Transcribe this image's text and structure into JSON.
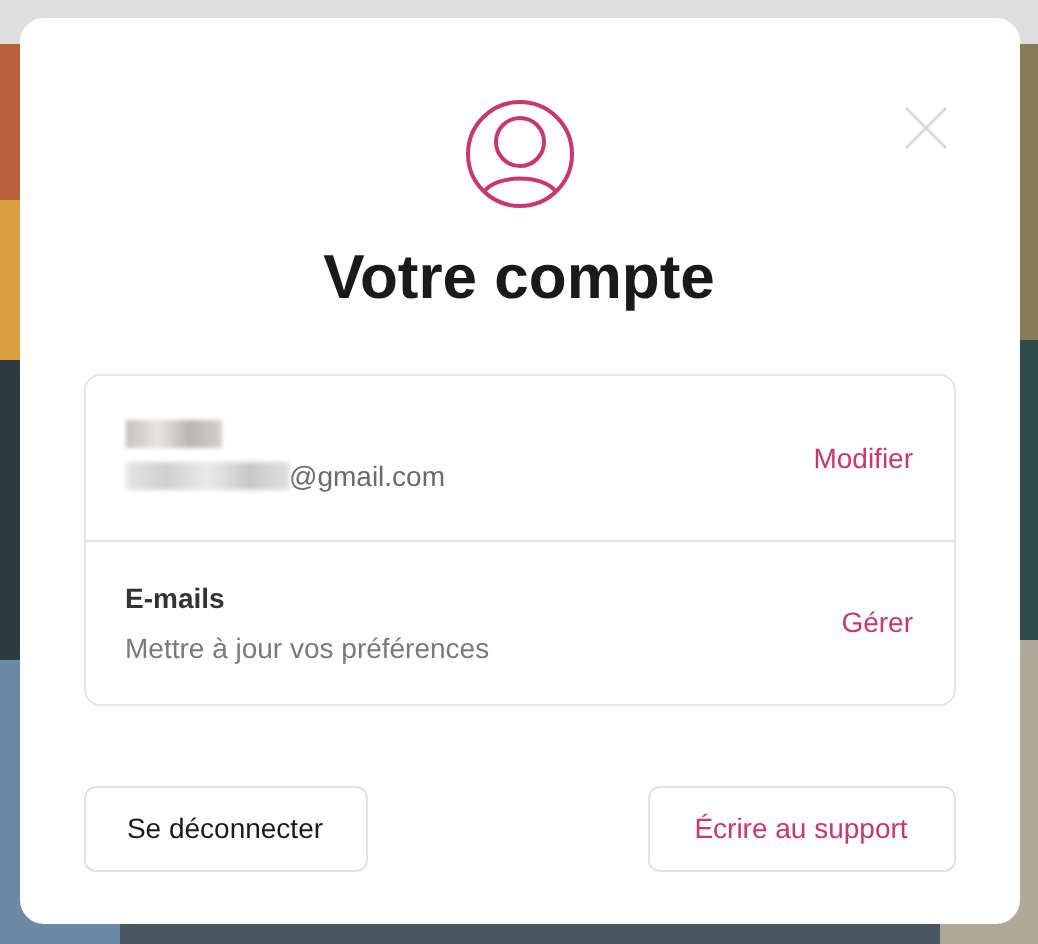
{
  "dialog": {
    "title": "Votre compte"
  },
  "account_rows": [
    {
      "kind": "profile",
      "email_visible": "@gmail.com",
      "action": "Modifier"
    },
    {
      "kind": "setting",
      "title": "E-mails",
      "subtitle": "Mettre à jour vos préférences",
      "action": "Gérer"
    }
  ],
  "buttons": [
    {
      "label": "Se déconnecter",
      "kind": "secondary"
    },
    {
      "label": "Écrire au support",
      "kind": "accent"
    }
  ]
}
